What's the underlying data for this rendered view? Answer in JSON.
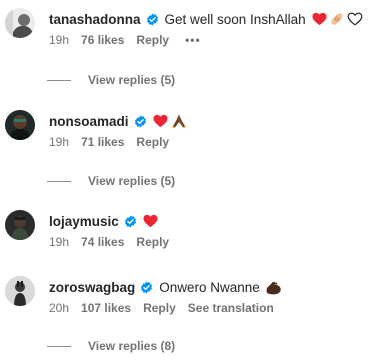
{
  "comments": [
    {
      "username": "tanashadonna",
      "text": "Get well soon InshAllah",
      "emoji": [
        "red-heart",
        "adhesive-bandage",
        "white-heart"
      ],
      "time": "19h",
      "likes": "76 likes",
      "reply": "Reply",
      "more": "•••",
      "view_replies": "View replies (5)"
    },
    {
      "username": "nonsoamadi",
      "text": "",
      "emoji": [
        "red-heart",
        "folded-hands"
      ],
      "time": "19h",
      "likes": "71 likes",
      "reply": "Reply",
      "view_replies": "View replies (5)"
    },
    {
      "username": "lojaymusic",
      "text": "",
      "emoji": [
        "red-heart"
      ],
      "time": "19h",
      "likes": "74 likes",
      "reply": "Reply"
    },
    {
      "username": "zoroswagbag",
      "text": "Onwero Nwanne",
      "emoji": [
        "flexed-biceps"
      ],
      "time": "20h",
      "likes": "107 likes",
      "reply": "Reply",
      "see_translation": "See translation",
      "view_replies": "View replies (8)"
    }
  ],
  "colors": {
    "verified_blue": "#0095f6",
    "meta_gray": "#737373",
    "heart_red": "#ed2433"
  }
}
